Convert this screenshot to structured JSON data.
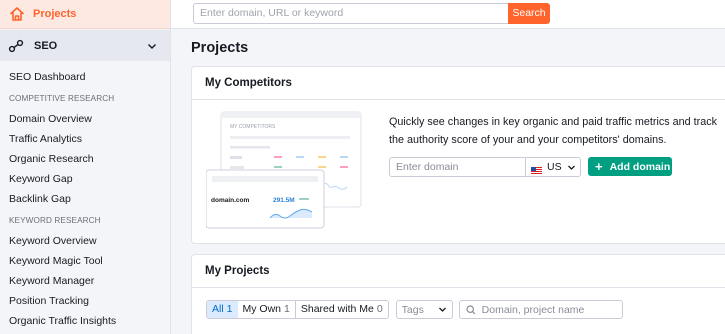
{
  "sidebar": {
    "projects_label": "Projects",
    "seo_label": "SEO",
    "items_top": [
      "SEO Dashboard"
    ],
    "section_competitive": "COMPETITIVE RESEARCH",
    "competitive_items": [
      "Domain Overview",
      "Traffic Analytics",
      "Organic Research",
      "Keyword Gap",
      "Backlink Gap"
    ],
    "section_keyword": "KEYWORD RESEARCH",
    "keyword_items": [
      "Keyword Overview",
      "Keyword Magic Tool",
      "Keyword Manager",
      "Position Tracking",
      "Organic Traffic Insights"
    ]
  },
  "search": {
    "placeholder": "Enter domain, URL or keyword",
    "button_label": "Search"
  },
  "page_title": "Projects",
  "competitors": {
    "title": "My Competitors",
    "description": "Quickly see changes in key organic and paid traffic metrics and track the authority score of your and your competitors' domains.",
    "domain_placeholder": "Enter domain",
    "country": "US",
    "add_label": "Add domain",
    "illustration": {
      "header": "MY COMPETITORS",
      "domain": "domain.com",
      "metric": "291.5M"
    }
  },
  "projects": {
    "title": "My Projects",
    "filters": [
      {
        "label": "All",
        "count": "1"
      },
      {
        "label": "My Own",
        "count": "1"
      },
      {
        "label": "Shared with Me",
        "count": "0"
      }
    ],
    "tags_placeholder": "Tags",
    "search_placeholder": "Domain, project name"
  },
  "colors": {
    "brand_orange": "#ff642d",
    "accent_green": "#009f81",
    "accent_blue": "#006dca"
  }
}
